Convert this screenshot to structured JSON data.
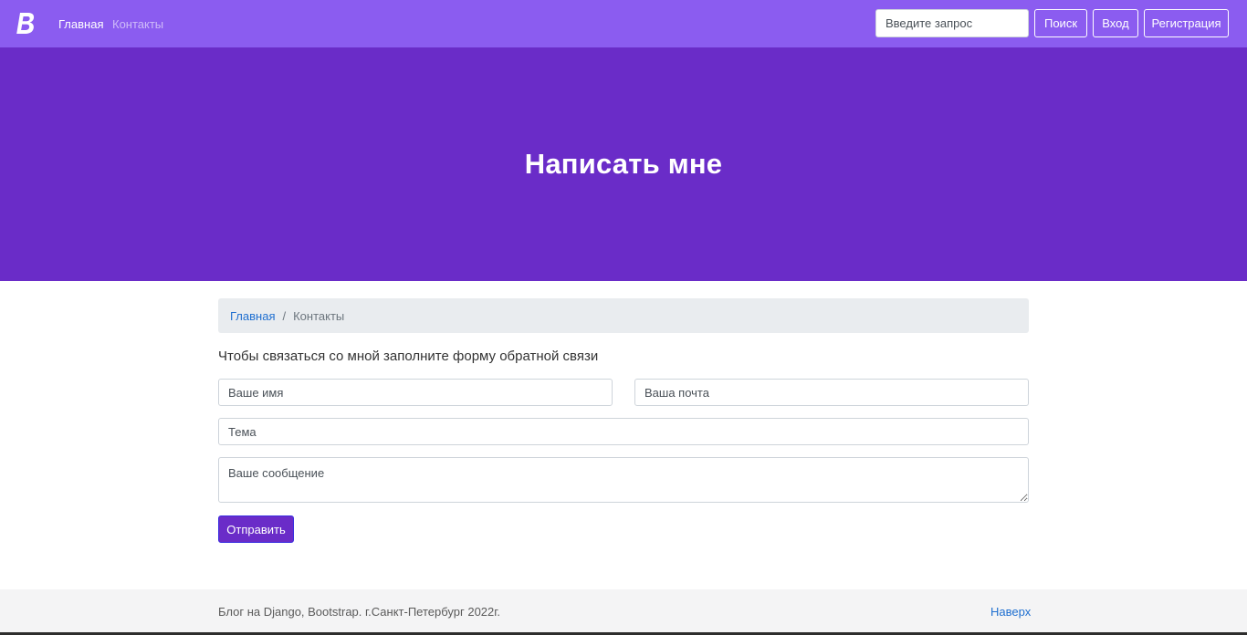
{
  "navbar": {
    "logo_icon": "bootstrap-b-logo",
    "links": [
      {
        "label": "Главная"
      },
      {
        "label": "Контакты"
      }
    ],
    "search": {
      "placeholder": "Введите запрос",
      "button_label": "Поиск"
    },
    "login_label": "Вход",
    "register_label": "Регистрация",
    "colors": {
      "background": "#8b5cf0"
    }
  },
  "hero": {
    "title": "Написать мне",
    "background": "#6a2cc8"
  },
  "breadcrumb": {
    "home": "Главная",
    "separator": "/",
    "current": "Контакты"
  },
  "form": {
    "intro": "Чтобы связаться со мной заполните форму обратной связи",
    "name_placeholder": "Ваше имя",
    "email_placeholder": "Ваша почта",
    "subject_placeholder": "Тема",
    "message_placeholder": "Ваше сообщение",
    "submit_label": "Отправить"
  },
  "footer": {
    "text": "Блог на Django, Bootstrap. г.Санкт-Петербург 2022г.",
    "back_to_top": "Наверх"
  }
}
